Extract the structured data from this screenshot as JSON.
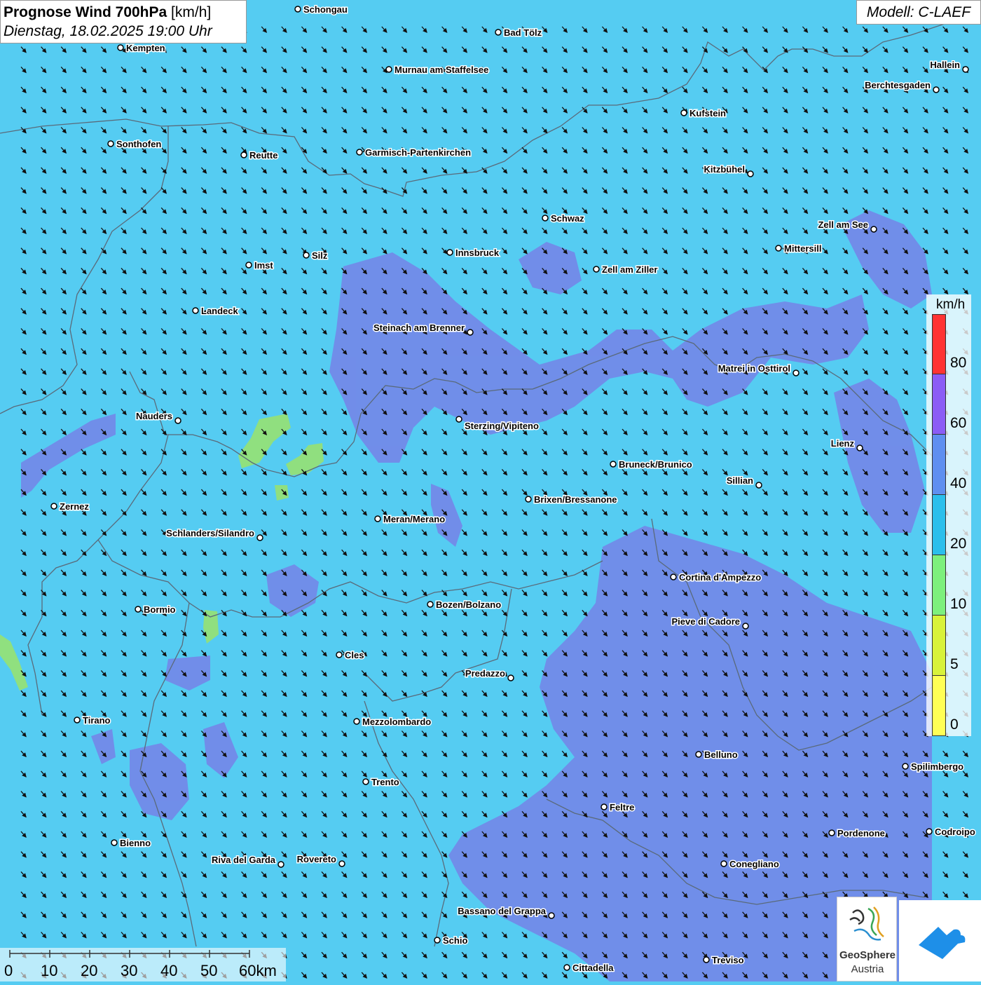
{
  "title": {
    "bold": "Prognose Wind 700hPa",
    "unit": " [km/h]",
    "datetime": "Dienstag, 18.02.2025 19:00 Uhr"
  },
  "model": "Modell: C-LAEF",
  "legend": {
    "unit": "km/h",
    "labels": [
      "80",
      "60",
      "40",
      "20",
      "10",
      "5",
      "0"
    ],
    "colors": [
      "#ff3333",
      "#8b5cf6",
      "#5f8ff0",
      "#2bbfec",
      "#7df07d",
      "#d8f23a",
      "#ffff55"
    ]
  },
  "scalebar": {
    "labels": [
      "0",
      "10",
      "20",
      "30",
      "40",
      "50",
      "60km"
    ]
  },
  "logo": {
    "line1": "GeoSphere",
    "line2": "Austria"
  },
  "colors": {
    "background": "#55ccf2",
    "strong": "#7683e8",
    "weak": "#9be36b",
    "border": "#5a6a7a"
  },
  "cities": [
    "Schongau",
    "Bad Tölz",
    "Kempten",
    "Murnau am Staffelsee",
    "Hallein",
    "Berchtesgaden",
    "Kufstein",
    "Sonthofen",
    "Reutte",
    "Garmisch-Partenkirchen",
    "Kitzbühel",
    "Schwaz",
    "Zell am See",
    "Innsbruck",
    "Mittersill",
    "Silz",
    "Imst",
    "Zell am Ziller",
    "Landeck",
    "Steinach am Brenner",
    "Matrei in Osttirol",
    "Nauders",
    "Sterzing/Vipiteno",
    "Lienz",
    "Bruneck/Brunico",
    "Sillian",
    "Brixen/Bressanone",
    "Zernez",
    "Meran/Merano",
    "Schlanders/Silandro",
    "Cortina d'Ampezzo",
    "Bozen/Bolzano",
    "Bormio",
    "Pieve di Cadore",
    "Cles",
    "Predazzo",
    "Tirano",
    "Mezzolombardo",
    "Belluno",
    "Spilimbergo",
    "Trento",
    "Feltre",
    "Bienno",
    "Pordenone",
    "Codroipo",
    "Riva del Garda",
    "Rovereto",
    "Conegliano",
    "Bassano del Grappa",
    "Schio",
    "Treviso",
    "Cittadella"
  ]
}
